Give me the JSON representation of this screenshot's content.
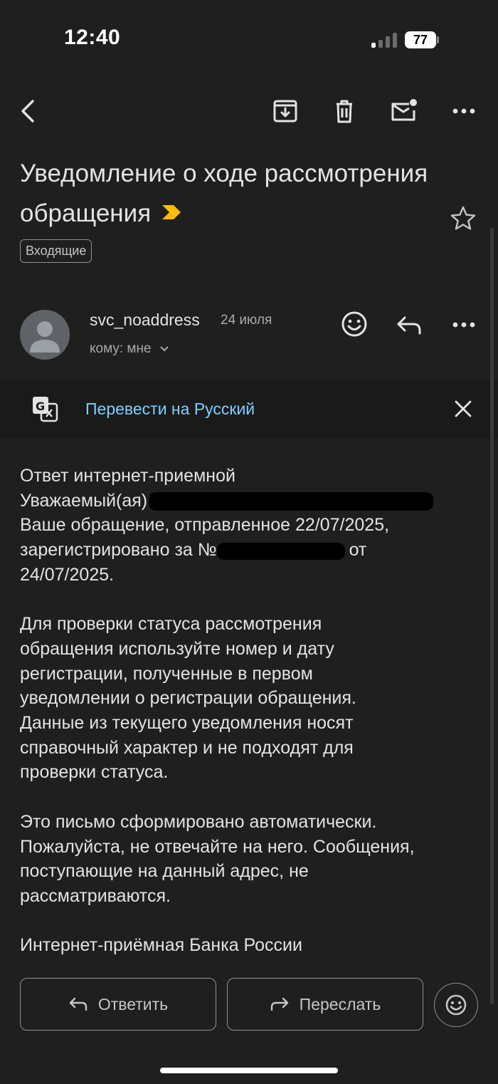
{
  "status_bar": {
    "time": "12:40",
    "battery": "77",
    "signal_icon": "cellular-signal-icon"
  },
  "toolbar": {
    "back_icon": "back-arrow-icon",
    "archive_icon": "archive-icon",
    "delete_icon": "trash-icon",
    "mark_unread_icon": "mark-unread-icon",
    "more_icon": "more-horizontal-icon"
  },
  "email": {
    "subject": "Уведомление о ходе рассмотрения обращения",
    "label": "Входящие",
    "importance_color": "#fbbc04",
    "sender_name": "svc_noaddress",
    "date": "24 июля",
    "recipient": "кому: мне"
  },
  "translate": {
    "link": "Перевести на Русский"
  },
  "body": {
    "line1": "Ответ интернет-приемной",
    "line2_prefix": "Уважаемый(ая)",
    "line3": "Ваше обращение, отправленное 22/07/2025,",
    "line4_prefix": "зарегистрировано за №",
    "line4_suffix": "от",
    "line5": "24/07/2025.",
    "para2": "Для проверки статуса рассмотрения\nобращения используйте номер и дату\nрегистрации, полученные в первом\nуведомлении о регистрации обращения.\nДанные из текущего уведомления носят\nсправочный характер и не подходят для\nпроверки статуса.",
    "para3": "Это письмо сформировано автоматически.\nПожалуйста, не отвечайте на него. Сообщения,\nпоступающие на данный адрес, не\nрассматриваются.",
    "signature": "Интернет-приёмная Банка России"
  },
  "actions": {
    "reply": "Ответить",
    "forward": "Переслать"
  }
}
